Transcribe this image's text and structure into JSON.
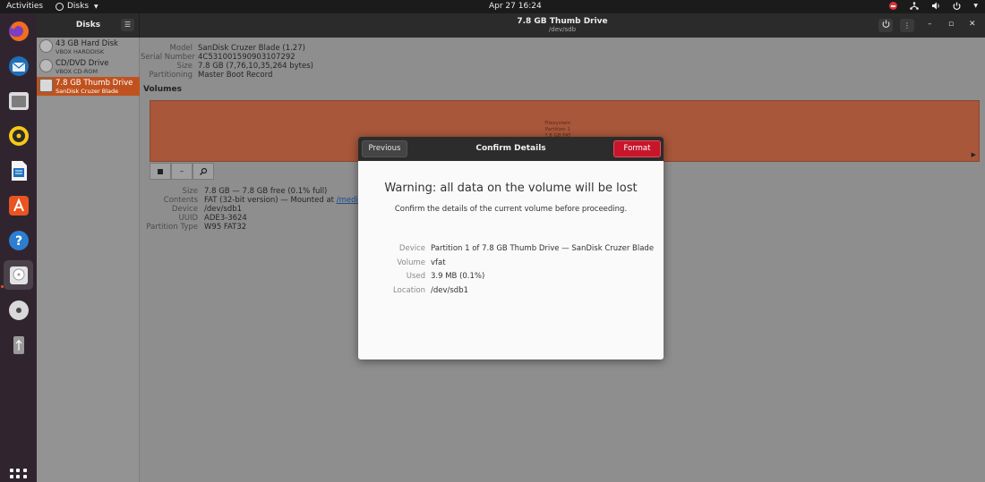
{
  "topbar": {
    "activities": "Activities",
    "app_name": "Disks",
    "clock": "Apr 27  16:24"
  },
  "dock": {
    "apps": [
      {
        "icon": "firefox-icon",
        "color": "#e66000"
      },
      {
        "icon": "thunderbird-icon",
        "color": "#1f6fb8"
      },
      {
        "icon": "files-icon",
        "color": "#7d7d7d"
      },
      {
        "icon": "rhythmbox-icon",
        "color": "#f6c915"
      },
      {
        "icon": "writer-icon",
        "color": "#1e73be"
      },
      {
        "icon": "software-icon",
        "color": "#e95420"
      },
      {
        "icon": "help-icon",
        "color": "#2d7ed1"
      },
      {
        "icon": "disks-icon",
        "color": "#cfcfcf"
      },
      {
        "icon": "dvd-icon",
        "color": "#bcbcbc"
      },
      {
        "icon": "usb-icon",
        "color": "#8a8a8a"
      }
    ]
  },
  "window": {
    "sidebar_title": "Disks",
    "title": "7.8 GB Thumb Drive",
    "subtitle": "/dev/sdb"
  },
  "disks": [
    {
      "name": "43 GB Hard Disk",
      "sub": "VBOX HARDDISK"
    },
    {
      "name": "CD/DVD Drive",
      "sub": "VBOX CD-ROM"
    },
    {
      "name": "7.8 GB Thumb Drive",
      "sub": "SanDisk Cruzer Blade"
    }
  ],
  "drive_props": {
    "model_label": "Model",
    "model": "SanDisk Cruzer Blade (1.27)",
    "serial_label": "Serial Number",
    "serial": "4C531001590903107292",
    "size_label": "Size",
    "size": "7.8 GB (7,76,10,35,264 bytes)",
    "partitioning_label": "Partitioning",
    "partitioning": "Master Boot Record"
  },
  "volumes": {
    "heading": "Volumes",
    "bar_text_1": "Filesystem",
    "bar_text_2": "Partition 1",
    "bar_text_3": "7.8 GB FAT"
  },
  "volume_props": {
    "size_label": "Size",
    "size": "7.8 GB — 7.8 GB free (0.1% full)",
    "contents_label": "Contents",
    "contents": "FAT (32-bit version) — Mounted at ",
    "contents_link": "/media/ak",
    "device_label": "Device",
    "device": "/dev/sdb1",
    "uuid_label": "UUID",
    "uuid": "ADE3-3624",
    "ptype_label": "Partition Type",
    "ptype": "W95 FAT32"
  },
  "dialog": {
    "title": "Confirm Details",
    "previous": "Previous",
    "format": "Format",
    "warning": "Warning: all data on the volume will be lost",
    "subtitle": "Confirm the details of the current volume before proceeding.",
    "device_label": "Device",
    "device": "Partition 1 of 7.8 GB Thumb Drive — SanDisk Cruzer Blade",
    "volume_label": "Volume",
    "volume": "vfat",
    "used_label": "Used",
    "used": "3.9 MB (0.1%)",
    "location_label": "Location",
    "location": "/dev/sdb1"
  }
}
